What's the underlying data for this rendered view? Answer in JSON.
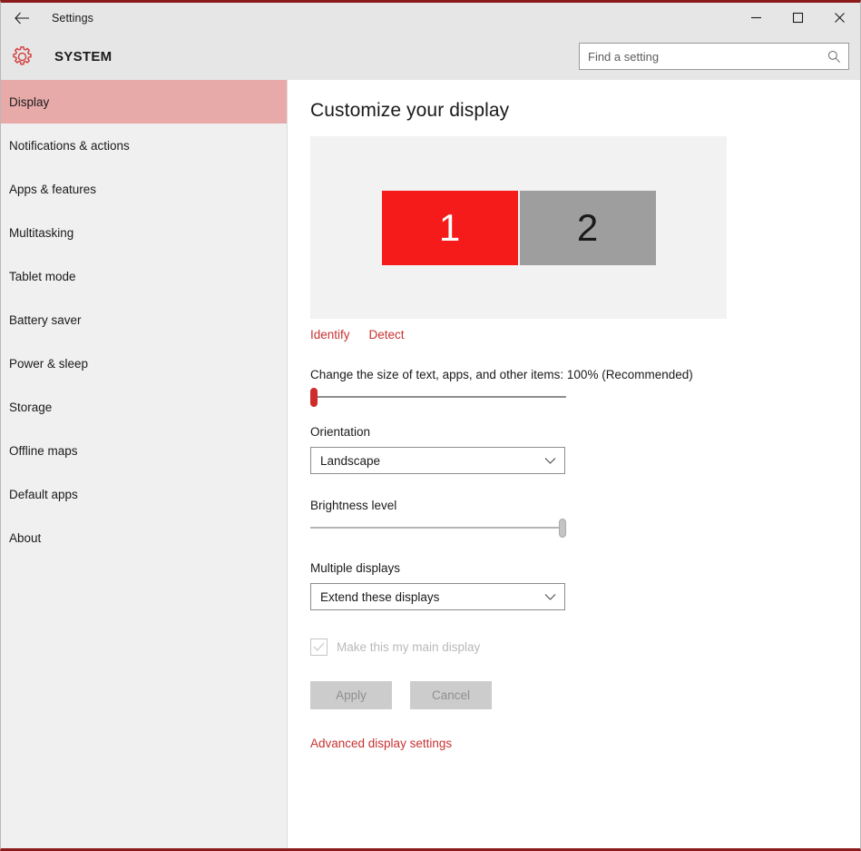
{
  "window": {
    "titlebar": {
      "back_icon": "back-arrow-icon",
      "title": "Settings",
      "minimize_icon": "minimize-icon",
      "maximize_icon": "maximize-icon",
      "close_icon": "close-icon"
    },
    "accent_color": "#8b1a1a"
  },
  "header": {
    "gear_icon": "gear-icon",
    "category_title": "SYSTEM",
    "search": {
      "placeholder": "Find a setting",
      "value": "",
      "icon": "search-icon"
    }
  },
  "sidebar": {
    "selected_index": 0,
    "selected_color": "#e8a9a9",
    "items": [
      {
        "label": "Display"
      },
      {
        "label": "Notifications & actions"
      },
      {
        "label": "Apps & features"
      },
      {
        "label": "Multitasking"
      },
      {
        "label": "Tablet mode"
      },
      {
        "label": "Battery saver"
      },
      {
        "label": "Power & sleep"
      },
      {
        "label": "Storage"
      },
      {
        "label": "Offline maps"
      },
      {
        "label": "Default apps"
      },
      {
        "label": "About"
      }
    ]
  },
  "main": {
    "page_title": "Customize your display",
    "display_preview": {
      "monitors": [
        {
          "number": "1",
          "state": "selected",
          "color": "#f51b1b"
        },
        {
          "number": "2",
          "state": "unselected",
          "color": "#9e9e9e"
        }
      ]
    },
    "links": {
      "identify": "Identify",
      "detect": "Detect",
      "advanced": "Advanced display settings",
      "color": "#c83232"
    },
    "scale": {
      "label": "Change the size of text, apps, and other items: 100% (Recommended)",
      "value": 100,
      "slider_position_percent": 0
    },
    "orientation": {
      "label": "Orientation",
      "value": "Landscape",
      "chevron_icon": "chevron-down-icon"
    },
    "brightness": {
      "label": "Brightness level",
      "slider_position_percent": 100
    },
    "multiple_displays": {
      "label": "Multiple displays",
      "value": "Extend these displays",
      "chevron_icon": "chevron-down-icon"
    },
    "main_display_checkbox": {
      "label": "Make this my main display",
      "checked": true,
      "enabled": false
    },
    "buttons": {
      "apply": "Apply",
      "cancel": "Cancel",
      "enabled": false
    }
  }
}
